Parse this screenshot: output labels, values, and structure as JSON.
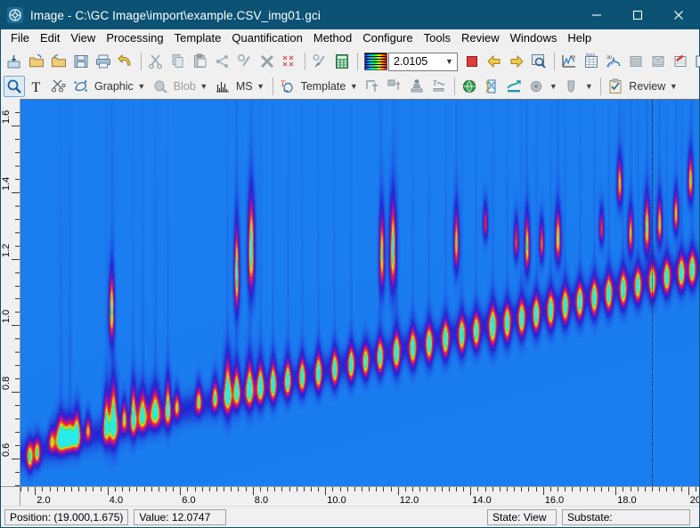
{
  "window": {
    "title": "Image - C:\\GC Image\\import\\example.CSV_img01.gci",
    "icon": "app-image-icon",
    "minimize_label": "─",
    "maximize_label": "☐",
    "close_label": "✕",
    "titlebar_color": "#0b5274"
  },
  "menubar": {
    "items": [
      {
        "label": "File"
      },
      {
        "label": "Edit"
      },
      {
        "label": "View"
      },
      {
        "label": "Processing"
      },
      {
        "label": "Template"
      },
      {
        "label": "Quantification"
      },
      {
        "label": "Method"
      },
      {
        "label": "Configure"
      },
      {
        "label": "Tools"
      },
      {
        "label": "Review"
      },
      {
        "label": "Windows"
      },
      {
        "label": "Help"
      }
    ]
  },
  "toolbar_main": {
    "buttons": [
      {
        "name": "import-image-icon",
        "tip": "Import"
      },
      {
        "name": "open-folder-icon",
        "tip": "Open"
      },
      {
        "name": "open-folder-up-icon",
        "tip": "Open recent"
      },
      {
        "name": "save-icon",
        "tip": "Save"
      },
      {
        "name": "print-icon",
        "tip": "Print"
      },
      {
        "name": "undo-arrow-icon",
        "tip": "Undo"
      },
      {
        "name": "cut-scissors-icon",
        "tip": "Cut"
      },
      {
        "name": "copy-icon",
        "tip": "Copy"
      },
      {
        "name": "paste-icon",
        "tip": "Paste"
      },
      {
        "name": "share-nodes-icon",
        "tip": "Link"
      },
      {
        "name": "pen-blob-icon",
        "tip": "Edit blob"
      },
      {
        "name": "delete-x-icon",
        "tip": "Delete"
      },
      {
        "name": "clear-xx-icon",
        "tip": "Clear all"
      },
      {
        "name": "paintbrush-icon",
        "tip": "Paint"
      },
      {
        "name": "calculator-icon",
        "tip": "Calculator"
      }
    ],
    "colorbar": {
      "name": "colormap-swatch-icon"
    },
    "zoom_combo": {
      "value": "2.0105",
      "placeholder": "2.0105"
    },
    "buttons_right": [
      {
        "name": "stop-square-icon",
        "tip": "Stop"
      },
      {
        "name": "back-arrow-icon",
        "tip": "Back"
      },
      {
        "name": "forward-arrow-icon",
        "tip": "Forward"
      },
      {
        "name": "zoom-region-icon",
        "tip": "Zoom region"
      },
      {
        "name": "chromatogram-chart-icon",
        "tip": "Chromatogram"
      },
      {
        "name": "data-table-icon",
        "tip": "Data table"
      },
      {
        "name": "3d-surface-icon",
        "tip": "3D view"
      },
      {
        "name": "report-gray-icon",
        "tip": "Report"
      },
      {
        "name": "report-gray2-icon",
        "tip": "Report 2"
      },
      {
        "name": "report-red-icon",
        "tip": "Report red"
      },
      {
        "name": "compare-images-icon",
        "tip": "Compare"
      }
    ]
  },
  "toolbar_tools": {
    "items": [
      {
        "name": "magnifier-icon",
        "label": "",
        "selected": true
      },
      {
        "name": "text-tool-icon",
        "label": ""
      },
      {
        "name": "scissors-pair-icon",
        "label": ""
      },
      {
        "name": "graphic-tool-icon",
        "label": "Graphic",
        "dropdown": true
      },
      {
        "name": "blob-tool-icon",
        "label": "Blob",
        "dropdown": true,
        "disabled": true
      },
      {
        "name": "ms-spectrum-icon",
        "label": "MS",
        "dropdown": true
      },
      {
        "name": "template-tool-icon",
        "label": "Template",
        "dropdown": true
      },
      {
        "name": "align-template-icon",
        "label": ""
      },
      {
        "name": "transform-template-icon",
        "label": ""
      },
      {
        "name": "stamp-icon",
        "label": ""
      },
      {
        "name": "baseline-icon",
        "label": ""
      },
      {
        "name": "globe-green-icon",
        "label": ""
      },
      {
        "name": "dna-strip-icon",
        "label": ""
      },
      {
        "name": "trend-teal-icon",
        "label": ""
      },
      {
        "name": "sphere-gray-icon",
        "label": "",
        "dropdown": true
      },
      {
        "name": "thumb-gray-icon",
        "label": "",
        "dropdown": true
      },
      {
        "name": "review-clipboard-icon",
        "label": "Review",
        "dropdown": true
      }
    ]
  },
  "chart_data": {
    "type": "heatmap",
    "title": "",
    "xlabel": "",
    "ylabel": "",
    "xlim": [
      1.6,
      20.3
    ],
    "ylim": [
      0.52,
      1.68
    ],
    "x_major_ticks": [
      "2.0",
      "4.0",
      "6.0",
      "8.0",
      "10.0",
      "12.0",
      "14.0",
      "16.0",
      "18.0",
      "20.0"
    ],
    "x_major_values": [
      2.0,
      4.0,
      6.0,
      8.0,
      10.0,
      12.0,
      14.0,
      16.0,
      18.0,
      20.0
    ],
    "x_minor_step": 0.2,
    "y_major_ticks": [
      "0.6",
      "0.8",
      "1.0",
      "1.2",
      "1.4",
      "1.6"
    ],
    "y_major_values": [
      0.6,
      0.8,
      1.0,
      1.2,
      1.4,
      1.6
    ],
    "y_minor_step": 0.04,
    "grid": false,
    "legend": "none",
    "background_color": "#1a7ef0",
    "colormap": [
      "#1a7ef0",
      "#2020e0",
      "#8000c0",
      "#e00060",
      "#ff4000",
      "#ffd000",
      "#40ff40",
      "#30f0f0"
    ],
    "cursor": {
      "x": 19.0,
      "y": 1.675
    },
    "peaks": [
      {
        "x": 1.85,
        "y": 0.6,
        "w": 0.1,
        "h": 0.03,
        "i": 0.75
      },
      {
        "x": 2.05,
        "y": 0.615,
        "w": 0.09,
        "h": 0.028,
        "i": 0.7
      },
      {
        "x": 2.45,
        "y": 0.655,
        "w": 0.09,
        "h": 0.024,
        "i": 0.6
      },
      {
        "x": 2.7,
        "y": 0.665,
        "w": 0.16,
        "h": 0.034,
        "i": 0.95
      },
      {
        "x": 2.95,
        "y": 0.665,
        "w": 0.18,
        "h": 0.03,
        "i": 0.9
      },
      {
        "x": 3.15,
        "y": 0.68,
        "w": 0.1,
        "h": 0.04,
        "i": 0.8
      },
      {
        "x": 3.45,
        "y": 0.69,
        "w": 0.08,
        "h": 0.026,
        "i": 0.62
      },
      {
        "x": 3.95,
        "y": 0.705,
        "w": 0.09,
        "h": 0.048,
        "i": 0.85
      },
      {
        "x": 4.15,
        "y": 0.715,
        "w": 0.13,
        "h": 0.06,
        "i": 1.0
      },
      {
        "x": 4.45,
        "y": 0.725,
        "w": 0.08,
        "h": 0.032,
        "i": 0.72
      },
      {
        "x": 4.7,
        "y": 0.73,
        "w": 0.09,
        "h": 0.05,
        "i": 0.88
      },
      {
        "x": 4.95,
        "y": 0.735,
        "w": 0.14,
        "h": 0.04,
        "i": 0.85
      },
      {
        "x": 5.3,
        "y": 0.745,
        "w": 0.16,
        "h": 0.038,
        "i": 0.86
      },
      {
        "x": 5.65,
        "y": 0.755,
        "w": 0.09,
        "h": 0.048,
        "i": 0.84
      },
      {
        "x": 5.9,
        "y": 0.76,
        "w": 0.08,
        "h": 0.028,
        "i": 0.65
      },
      {
        "x": 4.1,
        "y": 1.035,
        "w": 0.08,
        "h": 0.065,
        "i": 0.95
      },
      {
        "x": 6.5,
        "y": 0.775,
        "w": 0.09,
        "h": 0.03,
        "i": 0.7
      },
      {
        "x": 6.95,
        "y": 0.785,
        "w": 0.09,
        "h": 0.034,
        "i": 0.72
      },
      {
        "x": 7.3,
        "y": 0.8,
        "w": 0.12,
        "h": 0.055,
        "i": 0.96
      },
      {
        "x": 7.55,
        "y": 0.805,
        "w": 0.1,
        "h": 0.042,
        "i": 0.88
      },
      {
        "x": 7.9,
        "y": 0.81,
        "w": 0.12,
        "h": 0.048,
        "i": 0.9
      },
      {
        "x": 8.2,
        "y": 0.815,
        "w": 0.11,
        "h": 0.044,
        "i": 0.88
      },
      {
        "x": 8.55,
        "y": 0.82,
        "w": 0.1,
        "h": 0.042,
        "i": 0.86
      },
      {
        "x": 7.55,
        "y": 1.145,
        "w": 0.08,
        "h": 0.08,
        "i": 0.95
      },
      {
        "x": 7.95,
        "y": 1.215,
        "w": 0.1,
        "h": 0.09,
        "i": 1.0
      },
      {
        "x": 8.95,
        "y": 0.83,
        "w": 0.1,
        "h": 0.04,
        "i": 0.84
      },
      {
        "x": 9.35,
        "y": 0.84,
        "w": 0.1,
        "h": 0.038,
        "i": 0.82
      },
      {
        "x": 9.8,
        "y": 0.85,
        "w": 0.1,
        "h": 0.04,
        "i": 0.84
      },
      {
        "x": 10.25,
        "y": 0.862,
        "w": 0.1,
        "h": 0.038,
        "i": 0.82
      },
      {
        "x": 10.7,
        "y": 0.875,
        "w": 0.1,
        "h": 0.038,
        "i": 0.82
      },
      {
        "x": 11.1,
        "y": 0.885,
        "w": 0.1,
        "h": 0.036,
        "i": 0.8
      },
      {
        "x": 11.5,
        "y": 0.898,
        "w": 0.1,
        "h": 0.038,
        "i": 0.82
      },
      {
        "x": 11.55,
        "y": 1.2,
        "w": 0.08,
        "h": 0.075,
        "i": 0.9
      },
      {
        "x": 11.85,
        "y": 1.215,
        "w": 0.1,
        "h": 0.085,
        "i": 0.98
      },
      {
        "x": 11.95,
        "y": 0.91,
        "w": 0.11,
        "h": 0.042,
        "i": 0.86
      },
      {
        "x": 12.4,
        "y": 0.922,
        "w": 0.11,
        "h": 0.04,
        "i": 0.84
      },
      {
        "x": 12.85,
        "y": 0.935,
        "w": 0.11,
        "h": 0.04,
        "i": 0.84
      },
      {
        "x": 13.3,
        "y": 0.948,
        "w": 0.11,
        "h": 0.04,
        "i": 0.84
      },
      {
        "x": 13.6,
        "y": 1.24,
        "w": 0.08,
        "h": 0.06,
        "i": 0.84
      },
      {
        "x": 13.75,
        "y": 0.96,
        "w": 0.11,
        "h": 0.04,
        "i": 0.84
      },
      {
        "x": 14.15,
        "y": 0.972,
        "w": 0.11,
        "h": 0.038,
        "i": 0.82
      },
      {
        "x": 14.4,
        "y": 1.305,
        "w": 0.07,
        "h": 0.035,
        "i": 0.7
      },
      {
        "x": 14.6,
        "y": 0.985,
        "w": 0.12,
        "h": 0.044,
        "i": 0.88
      },
      {
        "x": 15.0,
        "y": 0.995,
        "w": 0.11,
        "h": 0.04,
        "i": 0.84
      },
      {
        "x": 15.25,
        "y": 1.25,
        "w": 0.07,
        "h": 0.04,
        "i": 0.74
      },
      {
        "x": 15.4,
        "y": 1.01,
        "w": 0.11,
        "h": 0.04,
        "i": 0.84
      },
      {
        "x": 15.55,
        "y": 1.23,
        "w": 0.08,
        "h": 0.055,
        "i": 0.9
      },
      {
        "x": 15.8,
        "y": 1.022,
        "w": 0.11,
        "h": 0.04,
        "i": 0.84
      },
      {
        "x": 15.95,
        "y": 1.245,
        "w": 0.07,
        "h": 0.04,
        "i": 0.78
      },
      {
        "x": 16.2,
        "y": 1.035,
        "w": 0.11,
        "h": 0.04,
        "i": 0.84
      },
      {
        "x": 16.4,
        "y": 1.255,
        "w": 0.09,
        "h": 0.05,
        "i": 0.9
      },
      {
        "x": 16.6,
        "y": 1.048,
        "w": 0.11,
        "h": 0.04,
        "i": 0.84
      },
      {
        "x": 17.0,
        "y": 1.06,
        "w": 0.11,
        "h": 0.04,
        "i": 0.84
      },
      {
        "x": 17.4,
        "y": 1.072,
        "w": 0.11,
        "h": 0.04,
        "i": 0.84
      },
      {
        "x": 17.6,
        "y": 1.29,
        "w": 0.07,
        "h": 0.035,
        "i": 0.72
      },
      {
        "x": 17.8,
        "y": 1.085,
        "w": 0.11,
        "h": 0.04,
        "i": 0.84
      },
      {
        "x": 18.1,
        "y": 1.42,
        "w": 0.08,
        "h": 0.045,
        "i": 0.84
      },
      {
        "x": 18.2,
        "y": 1.098,
        "w": 0.11,
        "h": 0.04,
        "i": 0.84
      },
      {
        "x": 18.4,
        "y": 1.27,
        "w": 0.08,
        "h": 0.045,
        "i": 0.82
      },
      {
        "x": 18.6,
        "y": 1.11,
        "w": 0.11,
        "h": 0.038,
        "i": 0.82
      },
      {
        "x": 18.85,
        "y": 1.285,
        "w": 0.09,
        "h": 0.055,
        "i": 0.92
      },
      {
        "x": 19.0,
        "y": 1.122,
        "w": 0.11,
        "h": 0.038,
        "i": 0.82
      },
      {
        "x": 19.2,
        "y": 1.3,
        "w": 0.08,
        "h": 0.045,
        "i": 0.86
      },
      {
        "x": 19.4,
        "y": 1.135,
        "w": 0.11,
        "h": 0.038,
        "i": 0.82
      },
      {
        "x": 19.65,
        "y": 1.33,
        "w": 0.08,
        "h": 0.04,
        "i": 0.84
      },
      {
        "x": 19.8,
        "y": 1.148,
        "w": 0.11,
        "h": 0.038,
        "i": 0.82
      },
      {
        "x": 20.05,
        "y": 1.43,
        "w": 0.08,
        "h": 0.045,
        "i": 0.86
      },
      {
        "x": 20.1,
        "y": 1.16,
        "w": 0.11,
        "h": 0.038,
        "i": 0.82
      }
    ]
  },
  "statusbar": {
    "position": "Position: (19.000,1.675)",
    "value": "Value: 12.0747",
    "state": "State: View",
    "substate": "Substate:"
  }
}
